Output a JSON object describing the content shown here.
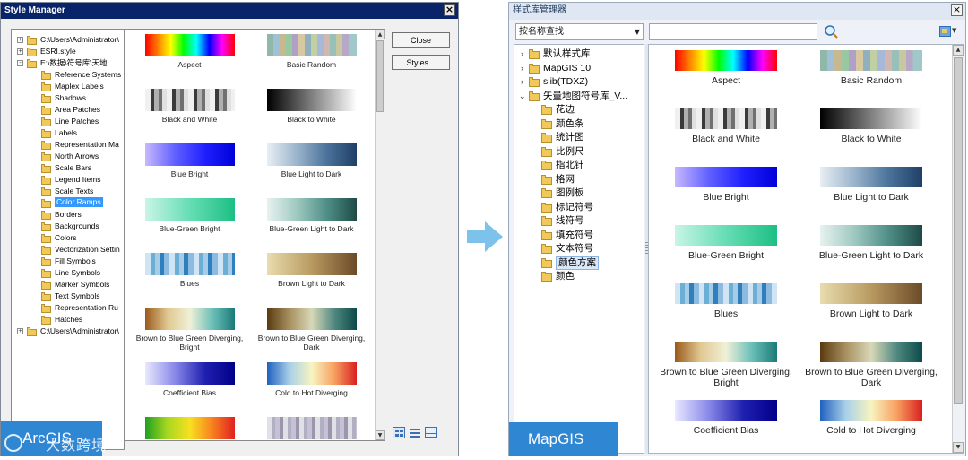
{
  "arcgis": {
    "title": "Style Manager",
    "close_glyph": "×",
    "buttons": {
      "close": "Close",
      "styles": "Styles..."
    },
    "tree": [
      {
        "label": "C:\\Users\\Administrator\\",
        "level": 0,
        "expander": "+"
      },
      {
        "label": "ESRI.style",
        "level": 0,
        "expander": "+"
      },
      {
        "label": "E:\\数据\\符号库\\天地",
        "level": 0,
        "expander": "-"
      },
      {
        "label": "Reference Systems",
        "level": 1
      },
      {
        "label": "Maplex Labels",
        "level": 1
      },
      {
        "label": "Shadows",
        "level": 1
      },
      {
        "label": "Area Patches",
        "level": 1
      },
      {
        "label": "Line Patches",
        "level": 1
      },
      {
        "label": "Labels",
        "level": 1
      },
      {
        "label": "Representation Ma",
        "level": 1
      },
      {
        "label": "North Arrows",
        "level": 1
      },
      {
        "label": "Scale Bars",
        "level": 1
      },
      {
        "label": "Legend Items",
        "level": 1
      },
      {
        "label": "Scale Texts",
        "level": 1
      },
      {
        "label": "Color Ramps",
        "level": 1,
        "selected": true
      },
      {
        "label": "Borders",
        "level": 1
      },
      {
        "label": "Backgrounds",
        "level": 1
      },
      {
        "label": "Colors",
        "level": 1
      },
      {
        "label": "Vectorization Settin",
        "level": 1
      },
      {
        "label": "Fill Symbols",
        "level": 1
      },
      {
        "label": "Line Symbols",
        "level": 1
      },
      {
        "label": "Marker Symbols",
        "level": 1
      },
      {
        "label": "Text Symbols",
        "level": 1
      },
      {
        "label": "Representation Ru",
        "level": 1
      },
      {
        "label": "Hatches",
        "level": 1
      },
      {
        "label": "C:\\Users\\Administrator\\",
        "level": 0,
        "expander": "+"
      }
    ],
    "ramps": [
      {
        "label": "Aspect",
        "key": "aspect"
      },
      {
        "label": "Basic Random",
        "key": "random"
      },
      {
        "label": "Black and White",
        "key": "bw"
      },
      {
        "label": "Black to White",
        "key": "btw"
      },
      {
        "label": "Blue Bright",
        "key": "bluebright"
      },
      {
        "label": "Blue Light to Dark",
        "key": "bluelight"
      },
      {
        "label": "Blue-Green Bright",
        "key": "bgbright"
      },
      {
        "label": "Blue-Green Light to Dark",
        "key": "bglight"
      },
      {
        "label": "Blues",
        "key": "blues"
      },
      {
        "label": "Brown Light to Dark",
        "key": "brown"
      },
      {
        "label": "Brown to Blue Green Diverging, Bright",
        "key": "bbgbright"
      },
      {
        "label": "Brown to Blue Green Diverging, Dark",
        "key": "bbgdark"
      },
      {
        "label": "Coefficient Bias",
        "key": "coef"
      },
      {
        "label": "Cold to Hot Diverging",
        "key": "coldhot"
      },
      {
        "label": "",
        "key": "partial1"
      },
      {
        "label": "",
        "key": "partial2"
      }
    ],
    "badge": "ArcGIS",
    "watermark": "大数跨境"
  },
  "mapgis": {
    "title": "样式库管理器",
    "close_glyph": "×",
    "search_mode": "按名称查找",
    "search_value": "",
    "tree": [
      {
        "label": "默认样式库",
        "level": 0,
        "expander": "›"
      },
      {
        "label": "MapGIS 10",
        "level": 0,
        "expander": "›"
      },
      {
        "label": "slib(TDXZ)",
        "level": 0,
        "expander": "›"
      },
      {
        "label": "矢量地图符号库_V...",
        "level": 0,
        "expander": "⌄"
      },
      {
        "label": "花边",
        "level": 1
      },
      {
        "label": "颜色条",
        "level": 1
      },
      {
        "label": "统计图",
        "level": 1
      },
      {
        "label": "比例尺",
        "level": 1
      },
      {
        "label": "指北针",
        "level": 1
      },
      {
        "label": "格网",
        "level": 1
      },
      {
        "label": "图例板",
        "level": 1
      },
      {
        "label": "标记符号",
        "level": 1
      },
      {
        "label": "线符号",
        "level": 1
      },
      {
        "label": "填充符号",
        "level": 1
      },
      {
        "label": "文本符号",
        "level": 1
      },
      {
        "label": "颜色方案",
        "level": 1,
        "selected": true
      },
      {
        "label": "颜色",
        "level": 1
      }
    ],
    "ramps": [
      {
        "label": "Aspect",
        "key": "aspect"
      },
      {
        "label": "Basic Random",
        "key": "random"
      },
      {
        "label": "Black and White",
        "key": "bw"
      },
      {
        "label": "Black to White",
        "key": "btw"
      },
      {
        "label": "Blue Bright",
        "key": "bluebright"
      },
      {
        "label": "Blue Light to Dark",
        "key": "bluelight"
      },
      {
        "label": "Blue-Green Bright",
        "key": "bgbright"
      },
      {
        "label": "Blue-Green Light to Dark",
        "key": "bglight"
      },
      {
        "label": "Blues",
        "key": "blues"
      },
      {
        "label": "Brown Light to Dark",
        "key": "brown"
      },
      {
        "label": "Brown to Blue Green Diverging, Bright",
        "key": "bbgbright"
      },
      {
        "label": "Brown to Blue Green Diverging, Dark",
        "key": "bbgdark"
      },
      {
        "label": "Coefficient Bias",
        "key": "coef"
      },
      {
        "label": "Cold to Hot Diverging",
        "key": "coldhot"
      }
    ],
    "badge": "MapGIS"
  },
  "colors": {
    "arcgis_title_bg": "#0a246a",
    "mapgis_title_bg": "#dfe7f2",
    "selection": "#3399ff",
    "badge": "#2f86d3",
    "arrow": "#7dc2ea"
  },
  "ramp_styles": {
    "aspect": "linear-gradient(90deg,#ff0000,#ff8000,#ffff00,#00ff00,#00ffff,#0000ff,#ff00ff,#ff0000)",
    "random": "linear-gradient(90deg,#8fb8a8 0 7%,#a0c0d8 7% 14%,#c8b890 14% 21%,#98c8a0 21% 28%,#b0a0c8 28% 35%,#d8c8a0 35% 42%,#90b0c0 42% 49%,#c0d0a0 49% 56%,#a8b8d8 56% 63%,#d0b8b0 63% 70%,#98c0b8 70% 77%,#c8c8a0 77% 84%,#b8a8c8 84% 91%,#a0c8c8 91% 100%)",
    "bw": "repeating-linear-gradient(90deg,#f0f0f0 0 6px,#3a3a3a 6px 10px,#b0b0b0 10px 15px,#707070 15px 19px,#e0e0e0 19px 24px)",
    "btw": "linear-gradient(90deg,#000000,#ffffff)",
    "bluebright": "linear-gradient(90deg,#c8b8ff,#6060ff,#2020ff,#0000d8)",
    "bluelight": "linear-gradient(90deg,#e8eef4,#9ab4cc,#4b739b,#1f3f66)",
    "bgbright": "linear-gradient(90deg,#c8f5e6,#66ddb4,#1cbf84)",
    "bglight": "linear-gradient(90deg,#e8f2f0,#9ec9c0,#4f8f88,#1e4a46)",
    "blues": "repeating-linear-gradient(90deg,#d0e4f4 0 6px,#6baed6 6px 11px,#a8cce6 11px 16px,#2f7fbf 16px 21px,#8dbbe0 21px 27px)",
    "brown": "linear-gradient(90deg,#e8dcae,#b89a60,#6b4a28)",
    "bbgbright": "linear-gradient(90deg,#9a5a1c,#e0c890,#f0f0d8,#6cc0b8,#1a7a78)",
    "bbgdark": "linear-gradient(90deg,#5a3a10,#a89060,#d8d8b8,#508880,#0c4a48)",
    "coef": "linear-gradient(90deg,#e8e8ff,#8888e8,#2020b0,#00008a)",
    "coldhot": "linear-gradient(90deg,#2060c0,#a8d0e8,#f8f4c0,#f8a060,#d82020)",
    "partial1": "linear-gradient(90deg,#20a020,#a8d820,#f8e020,#f88020,#e02020)",
    "partial2": "repeating-linear-gradient(90deg,#e0e0e8 0 5px,#b0b0c0 5px 9px,#c8c0d8 9px 14px,#9898a8 14px 18px)"
  }
}
